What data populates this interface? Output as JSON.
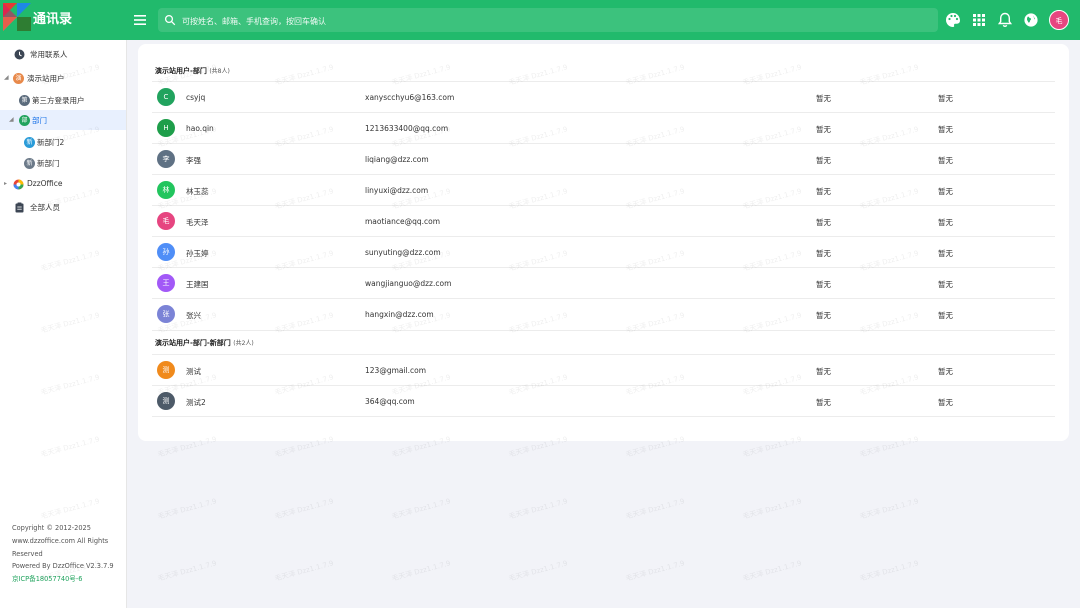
{
  "app": {
    "title": "通讯录"
  },
  "search": {
    "placeholder": "可按姓名、邮箱、手机查询，按回车确认"
  },
  "header_icons": [
    "palette-icon",
    "apps-grid-icon",
    "bell-icon",
    "globe-icon"
  ],
  "user": {
    "avatar_text": "毛",
    "avatar_color": "#e64580"
  },
  "sidebar": {
    "items": [
      {
        "label": "常用联系人",
        "icon": "clock-icon"
      },
      {
        "label": "演示站用户",
        "icon": "org-avatar",
        "avatar_text": "演",
        "color": "#e8894a"
      },
      {
        "label": "第三方登录用户",
        "icon": "org-avatar",
        "avatar_text": "第",
        "color": "#5b6b7c"
      },
      {
        "label": "部门",
        "icon": "org-avatar",
        "avatar_text": "部",
        "color": "#21a35e"
      },
      {
        "label": "新部门2",
        "icon": "org-avatar",
        "avatar_text": "新",
        "color": "#2a9bd8"
      },
      {
        "label": "新部门",
        "icon": "org-avatar",
        "avatar_text": "新",
        "color": "#6c7a89"
      },
      {
        "label": "DzzOffice",
        "icon": "dzz-logo-icon"
      },
      {
        "label": "全部人员",
        "icon": "clipboard-icon"
      }
    ],
    "footer": {
      "line1": "Copyright © 2012-2025",
      "line2": "www.dzzoffice.com All Rights",
      "line3": "Reserved",
      "line4": "Powered By DzzOffice V2.3.7.9",
      "icp": "京ICP备18057740号-6"
    }
  },
  "groups": [
    {
      "title": "演示站用户-部门",
      "count": "(共8人)",
      "members": [
        {
          "avatar": "C",
          "color": "#21a35e",
          "name": "csyjq",
          "email": "xanyscchyu6@163.com",
          "field1": "暂无",
          "field2": "暂无"
        },
        {
          "avatar": "H",
          "color": "#1e9e4a",
          "name": "hao.qin",
          "email": "1213633400@qq.com",
          "field1": "暂无",
          "field2": "暂无"
        },
        {
          "avatar": "李",
          "color": "#5f7184",
          "name": "李强",
          "email": "liqiang@dzz.com",
          "field1": "暂无",
          "field2": "暂无"
        },
        {
          "avatar": "林",
          "color": "#22c55e",
          "name": "林玉蕊",
          "email": "linyuxi@dzz.com",
          "field1": "暂无",
          "field2": "暂无"
        },
        {
          "avatar": "毛",
          "color": "#e64580",
          "name": "毛天泽",
          "email": "maotiance@qq.com",
          "field1": "暂无",
          "field2": "暂无"
        },
        {
          "avatar": "孙",
          "color": "#4f8ef7",
          "name": "孙玉婷",
          "email": "sunyuting@dzz.com",
          "field1": "暂无",
          "field2": "暂无"
        },
        {
          "avatar": "王",
          "color": "#a259f7",
          "name": "王建国",
          "email": "wangjianguo@dzz.com",
          "field1": "暂无",
          "field2": "暂无"
        },
        {
          "avatar": "张",
          "color": "#7b83d6",
          "name": "张兴",
          "email": "hangxin@dzz.com",
          "field1": "暂无",
          "field2": "暂无"
        }
      ]
    },
    {
      "title": "演示站用户-部门-新部门",
      "count": "(共2人)",
      "members": [
        {
          "avatar": "测",
          "color": "#f08a1c",
          "name": "测试",
          "email": "123@gmail.com",
          "field1": "暂无",
          "field2": "暂无"
        },
        {
          "avatar": "测",
          "color": "#4d5a68",
          "name": "测试2",
          "email": "364@qq.com",
          "field1": "暂无",
          "field2": "暂无"
        }
      ]
    }
  ],
  "watermark": "毛天泽 Dzz1.1.7.9"
}
